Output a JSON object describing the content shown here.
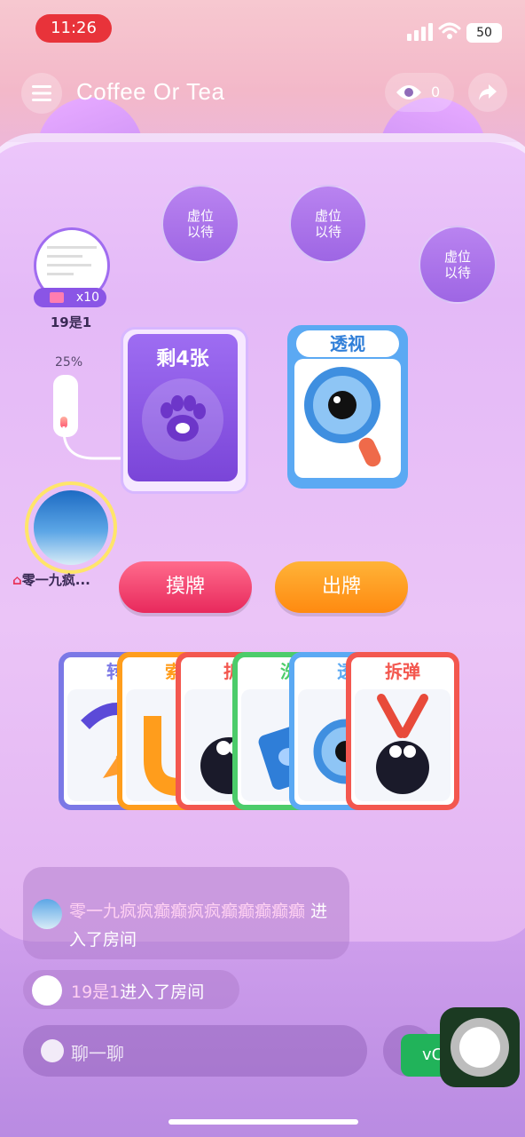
{
  "status_bar": {
    "time": "11:26",
    "battery": "50"
  },
  "header": {
    "title": "Coffee Or Tea",
    "viewer_count": "0"
  },
  "seats": [
    {
      "label_line1": "虚位",
      "label_line2": "以待"
    },
    {
      "label_line1": "虚位",
      "label_line2": "以待"
    },
    {
      "label_line1": "虚位",
      "label_line2": "以待"
    }
  ],
  "players": [
    {
      "name": "19是1",
      "badge": "x10",
      "percent": "25%",
      "percent_value": 0.25
    },
    {
      "name": "零一九疯..."
    }
  ],
  "deck": {
    "label": "剩4张"
  },
  "peek_card": {
    "label": "透视"
  },
  "actions": {
    "draw": "摸牌",
    "play": "出牌"
  },
  "hand": [
    {
      "label": "转",
      "color": "#7b78e6"
    },
    {
      "label": "索",
      "color": "#ff9d1c"
    },
    {
      "label": "拆",
      "color": "#f3574f"
    },
    {
      "label": "洗",
      "color": "#4ccc6a"
    },
    {
      "label": "透",
      "color": "#5ba9f3"
    },
    {
      "label": "拆弹",
      "color": "#f3574f"
    }
  ],
  "chat": [
    {
      "name": "零一九疯疯癫癫疯疯癫癫癫癫癫",
      "text": "进入了房间"
    },
    {
      "name": "19是1",
      "text": "进入了房间"
    }
  ],
  "input": {
    "placeholder": "聊一聊"
  },
  "side_button": {
    "label": "vC"
  }
}
